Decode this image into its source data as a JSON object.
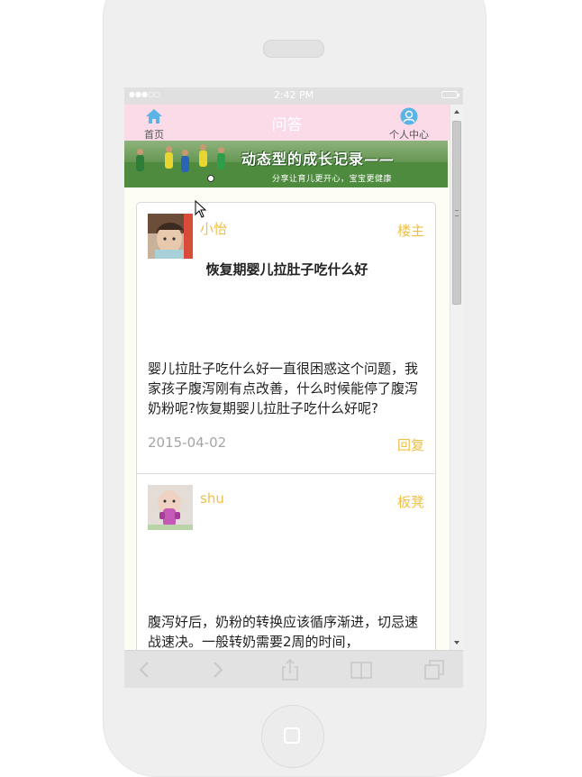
{
  "status_bar": {
    "signal": "●●●○○",
    "time": "2:42 PM"
  },
  "nav": {
    "home_label": "首页",
    "title": "问答",
    "user_label": "个人中心"
  },
  "banner": {
    "slogan": "动态型的成长记录——",
    "subslogan": "分享让育儿更开心，宝宝更健康"
  },
  "posts": [
    {
      "username": "小怡",
      "role": "楼主",
      "title": "恢复期婴儿拉肚子吃什么好",
      "content": "婴儿拉肚子吃什么好一直很困惑这个问题，我家孩子腹泻刚有点改善，什么时候能停了腹泻奶粉呢?恢复期婴儿拉肚子吃什么好呢?",
      "date": "2015-04-02",
      "reply_label": "回复"
    },
    {
      "username": "shu",
      "role": "板凳",
      "content": "腹泻好后，奶粉的转换应该循序渐进，切忌速战速决。一般转奶需要2周的时间，"
    }
  ],
  "colors": {
    "nav_bg": "#fadbe7",
    "accent": "#f0c046",
    "page_bg": "#fdfdf4"
  }
}
